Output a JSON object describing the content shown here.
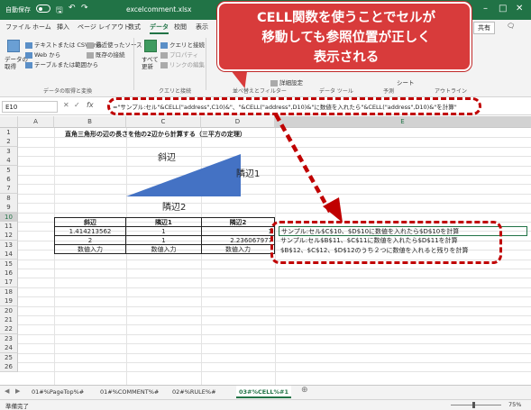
{
  "titlebar": {
    "autosave_label": "自動保存",
    "toggle_state": "オフ",
    "filename": "excelcomment.xlsx"
  },
  "ribbon_tabs": [
    {
      "label": "ファイル"
    },
    {
      "label": "ホーム"
    },
    {
      "label": "挿入"
    },
    {
      "label": "ページ レイアウト"
    },
    {
      "label": "数式"
    },
    {
      "label": "データ",
      "active": true
    },
    {
      "label": "校閲"
    },
    {
      "label": "表示"
    }
  ],
  "share_label": "共有",
  "comment_label": "コメント",
  "ribbon": {
    "get_data_label": "データの\n取得",
    "items": {
      "text_csv": "テキストまたは CSV から",
      "web": "Web から",
      "table_range": "テーブルまたは範囲から",
      "recent_sources": "最近使ったソース",
      "existing_connections": "既存の接続",
      "refresh_all": "すべて\n更新",
      "queries_connections": "クエリと接続",
      "properties": "プロパティ",
      "edit_links": "リンクの編集",
      "detail_settings": "詳細設定",
      "sheet": "シート"
    },
    "groups": {
      "get_transform": "データの取得と変換",
      "queries": "クエリと接続",
      "sort_filter": "並べ替えとフィルター",
      "data_tools": "データ ツール",
      "forecast": "予測",
      "outline": "アウトライン"
    }
  },
  "formula_bar": {
    "name_box": "E10",
    "fx": "fx",
    "formula": "=\"サンプル:セル\"&CELL(\"address\",C10)&\"、\"&CELL(\"address\",D10)&\"に数値を入れたら\"&CELL(\"address\",D10)&\"を計算\""
  },
  "columns": [
    "A",
    "B",
    "C",
    "D",
    "E"
  ],
  "rows": [
    "1",
    "2",
    "3",
    "4",
    "5",
    "6",
    "7",
    "8",
    "9",
    "10",
    "11",
    "12",
    "13",
    "14",
    "15",
    "16",
    "17",
    "18",
    "19",
    "20",
    "21",
    "22",
    "23",
    "24",
    "25",
    "26"
  ],
  "sheet": {
    "title": "直角三角形の辺の長さを他の2辺から計算する（三平方の定理）",
    "label_hypotenuse": "斜辺",
    "label_adjacent1": "隣辺1",
    "label_adjacent2": "隣辺2",
    "table_headers": [
      "斜辺",
      "隣辺1",
      "隣辺2"
    ],
    "table_rows": [
      [
        "1.414213562",
        "1",
        "1"
      ],
      [
        "2",
        "1",
        "2.236067977"
      ],
      [
        "数値入力",
        "数値入力",
        "数値入力"
      ]
    ],
    "e_col": [
      "サンプル:セル$C$10、$D$10に数値を入れたら$D$10を計算",
      "サンプル:セル$B$11、$C$11に数値を入れたら$D$11を計算",
      "$B$12、$C$12、$D$12のうち２つに数値を入れると残りを計算"
    ]
  },
  "callout": {
    "line1": "CELL関数を使うことでセルが",
    "line2": "移動しても参照位置が正しく",
    "line3": "表示される"
  },
  "sheet_tabs": [
    {
      "label": "01#%PageTop%#"
    },
    {
      "label": "01#%COMMENT%#"
    },
    {
      "label": "02#%RULE%#"
    },
    {
      "label": "03#%CELL%#1",
      "active": true
    }
  ],
  "status": {
    "ready": "準備完了",
    "zoom": "75%"
  },
  "colors": {
    "excel_green": "#217346",
    "callout_red": "#d83b3b",
    "dash_red": "#c00000",
    "triangle_blue": "#4472c4"
  }
}
